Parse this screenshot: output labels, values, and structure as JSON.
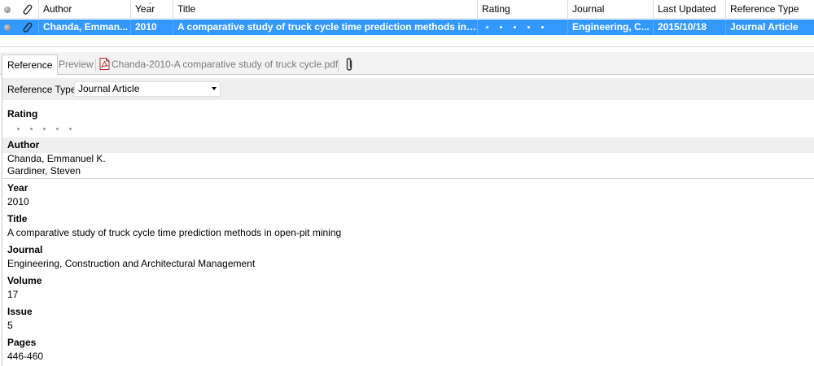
{
  "list": {
    "columns": {
      "author": "Author",
      "year": "Year",
      "title": "Title",
      "rating": "Rating",
      "journal": "Journal",
      "last_updated": "Last Updated",
      "reference_type": "Reference Type"
    },
    "selected_row": {
      "author": "Chanda, Emman...",
      "year": "2010",
      "title": "A comparative study of truck cycle time prediction methods in ...",
      "journal": "Engineering, C...",
      "last_updated": "2015/10/18",
      "reference_type": "Journal Article",
      "rating": 0
    }
  },
  "tabs": {
    "reference": "Reference",
    "preview": "Preview",
    "attachment": "Chanda-2010-A comparative study of truck cycle.pdf"
  },
  "reference": {
    "type_label": "Reference Type:",
    "type_value": "Journal Article",
    "rating_label": "Rating",
    "rating_value": 0,
    "author_label": "Author",
    "authors": [
      "Chanda, Emmanuel K.",
      "Gardiner, Steven"
    ],
    "year_label": "Year",
    "year": "2010",
    "title_label": "Title",
    "title": "A comparative study of truck cycle time prediction methods in open-pit mining",
    "journal_label": "Journal",
    "journal": "Engineering, Construction and Architectural Management",
    "volume_label": "Volume",
    "volume": "17",
    "issue_label": "Issue",
    "issue": "5",
    "pages_label": "Pages",
    "pages": "446-460"
  },
  "icons": {
    "read_status": "read-status-dot-icon",
    "attachment": "paperclip-icon",
    "pdf": "pdf-file-icon"
  },
  "colors": {
    "selection": "#3399ff",
    "panel_gray": "#eeeeee"
  }
}
